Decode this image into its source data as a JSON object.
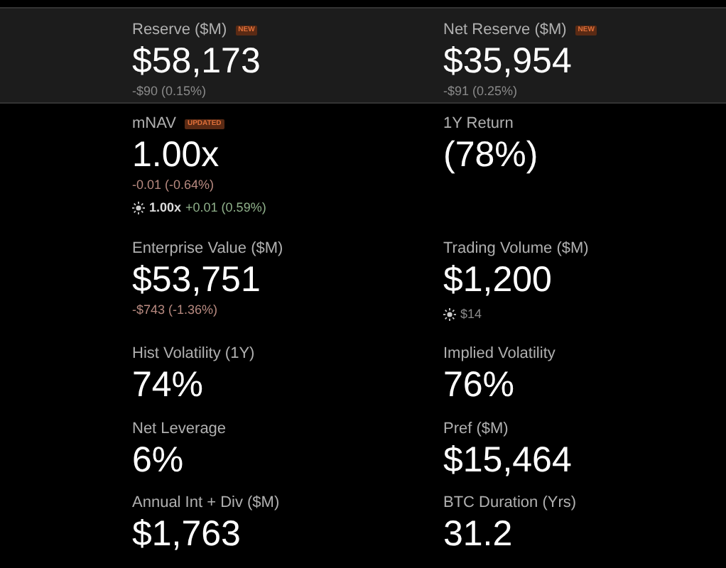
{
  "header_metrics": [
    {
      "label": "Reserve ($M)",
      "badge": "NEW",
      "value": "$58,173",
      "change": {
        "text": "-$90 (0.15%)",
        "color": "#8a8a8a"
      }
    },
    {
      "label": "Net Reserve ($M)",
      "badge": "NEW",
      "value": "$35,954",
      "change": {
        "text": "-$91 (0.25%)",
        "color": "#8a8a8a"
      }
    }
  ],
  "metrics": [
    {
      "label": "mNAV",
      "badge": "UPDATED",
      "value": "1.00x",
      "change": {
        "text": "-0.01 (-0.64%)",
        "color": "#b88a80"
      },
      "extended": {
        "value": "1.00x",
        "change": "+0.01 (0.59%)",
        "color": "#8fb08a"
      }
    },
    {
      "label": "1Y Return",
      "value": "(78%)"
    },
    {
      "label": "Enterprise Value ($M)",
      "value": "$53,751",
      "change": {
        "text": "-$743 (-1.36%)",
        "color": "#b88a80"
      }
    },
    {
      "label": "Trading Volume ($M)",
      "value": "$1,200",
      "extended": {
        "change": "$14",
        "color": "#8a8a8a"
      }
    },
    {
      "label": "Hist Volatility (1Y)",
      "value": "74%"
    },
    {
      "label": "Implied Volatility",
      "value": "76%"
    },
    {
      "label": "Net Leverage",
      "value": "6%"
    },
    {
      "label": "Pref ($M)",
      "value": "$15,464"
    },
    {
      "label": "Annual Int + Div ($M)",
      "value": "$1,763"
    },
    {
      "label": "BTC Duration (Yrs)",
      "value": "31.2"
    }
  ]
}
